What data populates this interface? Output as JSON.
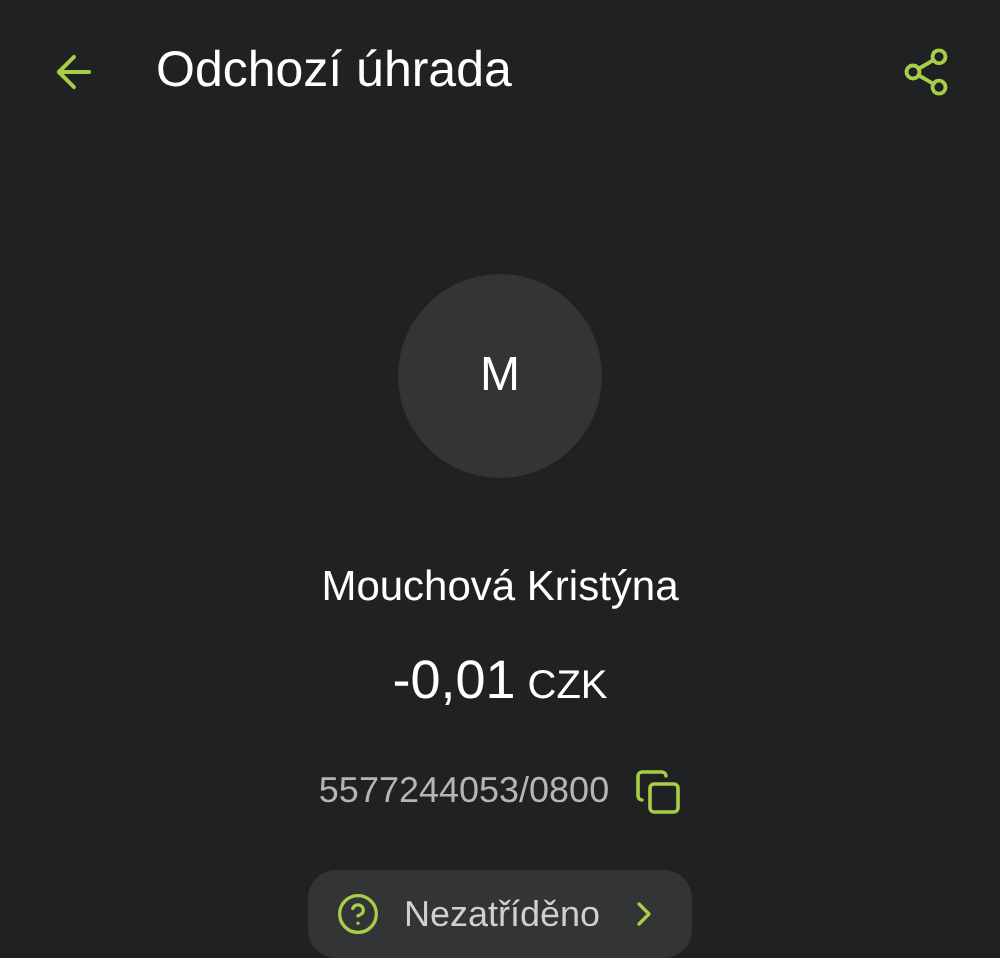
{
  "header": {
    "title": "Odchozí úhrada"
  },
  "counterparty": {
    "initial": "M",
    "name": "Mouchová Kristýna"
  },
  "amount": {
    "value": "-0,01",
    "currency": "CZK"
  },
  "account": {
    "number": "5577244053/0800"
  },
  "category": {
    "label": "Nezatříděno"
  }
}
